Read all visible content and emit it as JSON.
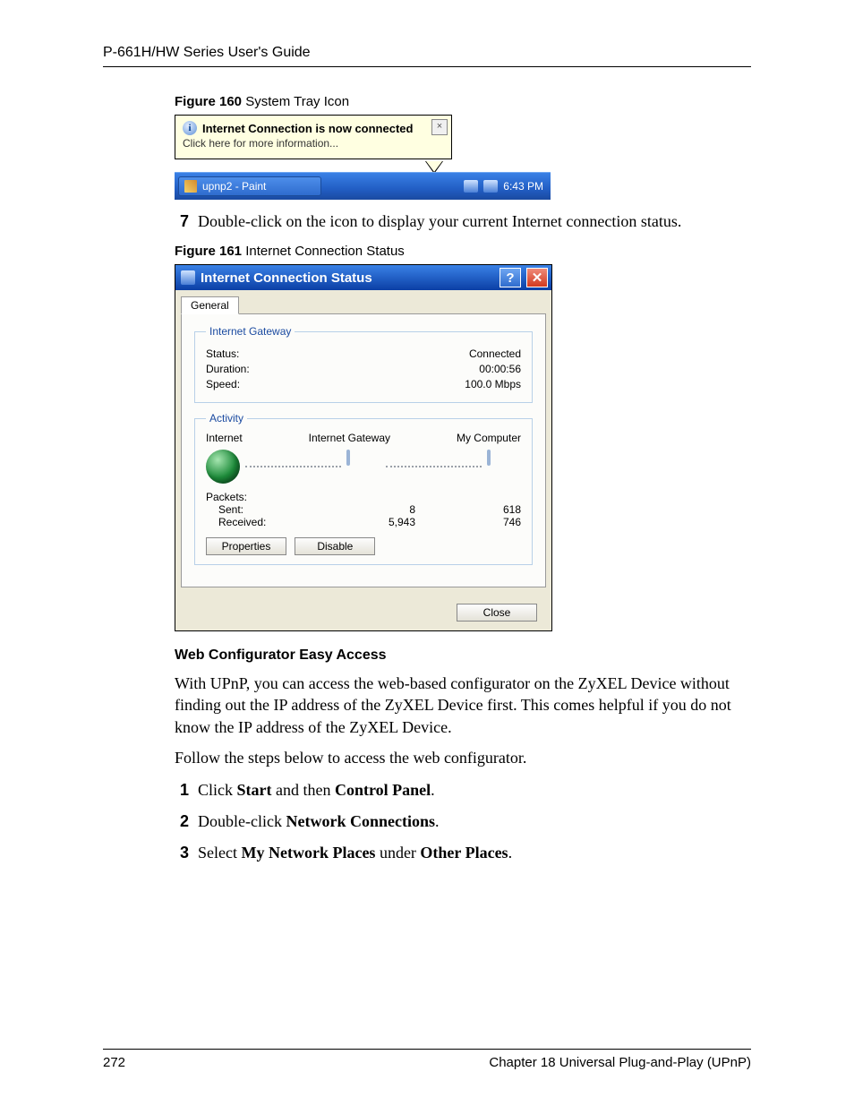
{
  "header": "P-661H/HW Series User's Guide",
  "fig160": {
    "caption_bold": "Figure 160",
    "caption_rest": "   System Tray Icon",
    "balloon_title": "Internet Connection is now connected",
    "balloon_sub": "Click here for more information...",
    "task_label": "upnp2 - Paint",
    "clock": "6:43 PM"
  },
  "step7": {
    "num": "7",
    "text": "Double-click on the icon to display your current Internet connection status."
  },
  "fig161": {
    "caption_bold": "Figure 161",
    "caption_rest": "   Internet Connection Status",
    "title": "Internet Connection Status",
    "tab": "General",
    "group_gateway": "Internet Gateway",
    "status_label": "Status:",
    "status_value": "Connected",
    "duration_label": "Duration:",
    "duration_value": "00:00:56",
    "speed_label": "Speed:",
    "speed_value": "100.0 Mbps",
    "group_activity": "Activity",
    "col_internet": "Internet",
    "col_gateway": "Internet Gateway",
    "col_mycomputer": "My Computer",
    "packets_label": "Packets:",
    "sent_label": "Sent:",
    "recv_label": "Received:",
    "sent_gw": "8",
    "recv_gw": "5,943",
    "sent_pc": "618",
    "recv_pc": "746",
    "btn_properties": "Properties",
    "btn_disable": "Disable",
    "btn_close": "Close"
  },
  "section_head": "Web Configurator Easy Access",
  "para1": "With UPnP, you can access the web-based configurator on the ZyXEL Device without finding out the IP address of the ZyXEL Device first. This comes helpful if you do not know the IP address of the ZyXEL Device.",
  "para2": "Follow the steps below to access the web configurator.",
  "steps": {
    "s1": {
      "num": "1",
      "pre": "Click ",
      "b1": "Start",
      "mid": " and then ",
      "b2": "Control Panel",
      "post": "."
    },
    "s2": {
      "num": "2",
      "pre": "Double-click ",
      "b1": "Network Connections",
      "post": "."
    },
    "s3": {
      "num": "3",
      "pre": "Select ",
      "b1": "My Network Places",
      "mid": " under ",
      "b2": "Other Places",
      "post": "."
    }
  },
  "footer": {
    "page": "272",
    "chapter": "Chapter 18 Universal Plug-and-Play (UPnP)"
  }
}
